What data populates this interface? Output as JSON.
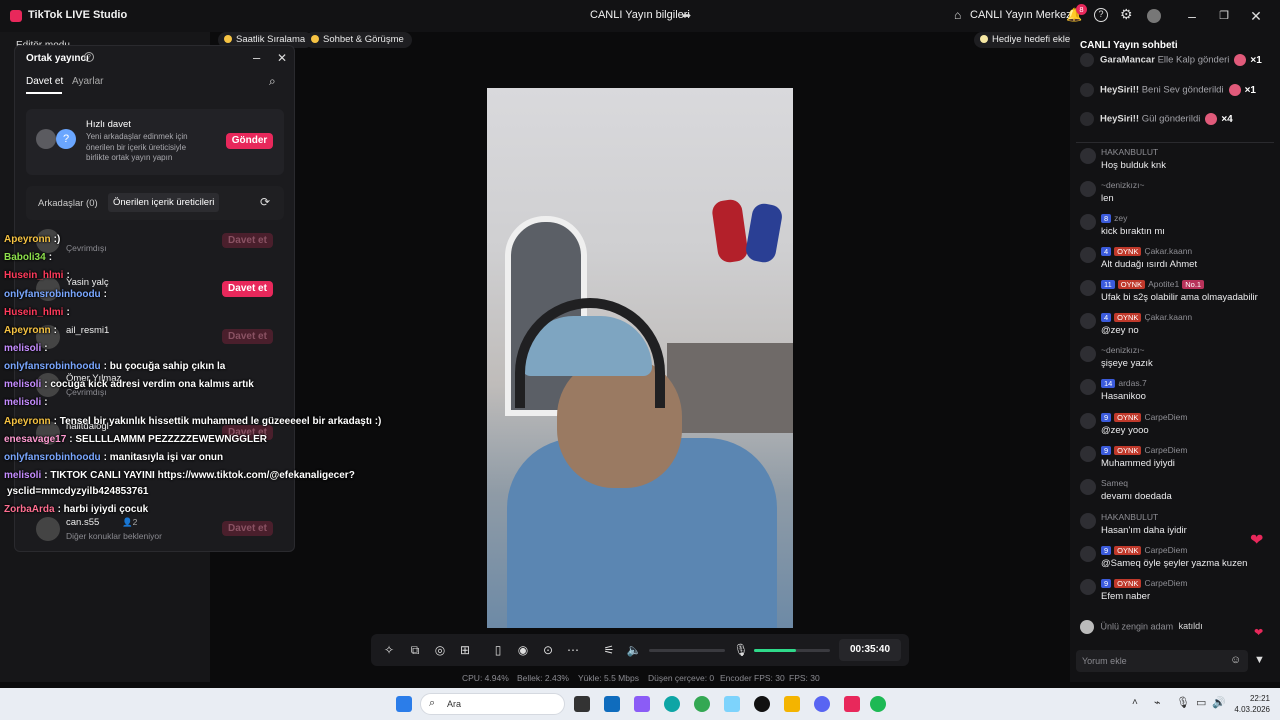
{
  "titlebar": {
    "app_name": "TikTok LIVE Studio",
    "center_title": "CANLI Yayın bilgileri",
    "live_center": "CANLI Yayın Merkezi",
    "notif_count": "8"
  },
  "left_panel": {
    "editor_mode": "Editör modu"
  },
  "scenes": {
    "pill1": "Saatlik Sıralama",
    "pill2": "Sohbet & Görüşme",
    "gift_goal": "Hediye hedefi ekle"
  },
  "cohost": {
    "title": "Ortak yayıncı",
    "tab_invite": "Davet et",
    "tab_settings": "Ayarlar",
    "quick_title": "Hızlı davet",
    "quick_desc": "Yeni arkadaşlar edinmek için önerilen bir içerik üreticisiyle birlikte ortak yayın yapın",
    "send": "Gönder",
    "seg_friends": "Arkadaşlar (0)",
    "seg_suggested": "Önerilen içerik üreticileri",
    "invite": "Davet et",
    "users": [
      {
        "name": "",
        "status": "Çevrimdışı"
      },
      {
        "name": "Yasin yalç",
        "status": ""
      },
      {
        "name": "ail_resmi1",
        "status": ""
      },
      {
        "name": "Ömer Yılmaz",
        "status": "Çevrimdışı"
      },
      {
        "name": "halitdalogl",
        "status": ""
      },
      {
        "name": "can.s55",
        "status": "Diğer konuklar bekleniyor",
        "count": "2"
      }
    ]
  },
  "overlay_chat": [
    {
      "user": "Apeyronn",
      "text": ":)",
      "color": "#f6c343"
    },
    {
      "user": "Baboli34",
      "text": ":",
      "color": "#8ee04c"
    },
    {
      "user": "Husein_hlmi",
      "text": ":",
      "color": "#ff3b5c"
    },
    {
      "user": "onlyfansrobinhoodu",
      "text": ":",
      "color": "#7aa7ff"
    },
    {
      "user": "Husein_hlmi",
      "text": ":",
      "color": "#ff3b5c"
    },
    {
      "user": "Apeyronn",
      "text": ":",
      "color": "#f6c343"
    },
    {
      "user": "melisoli",
      "text": ":",
      "color": "#c58cff"
    },
    {
      "user": "onlyfansrobinhoodu",
      "text": ": bu çocuğa sahip çıkın la",
      "color": "#7aa7ff"
    },
    {
      "user": "melisoli",
      "text": ": cocuga kick adresi verdim ona kalmıs artık",
      "color": "#c58cff"
    },
    {
      "user": "melisoli",
      "text": ":",
      "color": "#c58cff"
    },
    {
      "user": "Apeyronn",
      "text": ": Tensel bir yakınlık hissettik muhammed le güzeeeeel bir arkadaştı :)",
      "color": "#f6c343"
    },
    {
      "user": "enesavage17",
      "text": ": SELLLLAMMM PEZZZZZEWEWNGGLER",
      "color": "#ff9bd2"
    },
    {
      "user": "onlyfansrobinhoodu",
      "text": ": manitasıyla işi var onun",
      "color": "#7aa7ff"
    },
    {
      "user": "melisoli",
      "text": ": TIKTOK CANLI YAYINI https://www.tiktok.com/@efekanaligecer?",
      "color": "#c58cff"
    },
    {
      "user": "",
      "text": "ysclid=mmcdyzyilb424853761",
      "color": "#ffffff"
    },
    {
      "user": "ZorbaArda",
      "text": ": harbi iyiydi çocuk",
      "color": "#ff6f91"
    }
  ],
  "controls": {
    "timer": "00:35:40",
    "mic_level": 0.55
  },
  "status": {
    "cpu": "CPU: 4.94%",
    "mem": "Bellek: 2.43%",
    "upload": "Yükle: 5.5 Mbps",
    "dropped": "Düşen çerçeve: 0",
    "encoder": "Encoder FPS: 30",
    "fps": "FPS: 30"
  },
  "chat": {
    "title": "CANLI Yayın sohbeti",
    "gifts": [
      {
        "user": "GaraMancar",
        "action": "Elle Kalp gönderi",
        "count": "×1"
      },
      {
        "user": "HeySiri!!",
        "action": "Beni Sev gönderildi",
        "count": "×1"
      },
      {
        "user": "HeySiri!!",
        "action": "Gül gönderildi",
        "count": "×4"
      }
    ],
    "messages": [
      {
        "lvl": "",
        "fan": "",
        "user": "HAKANBULUT",
        "text": "Hoş bulduk knk"
      },
      {
        "lvl": "",
        "fan": "",
        "user": "~denizkızı~",
        "text": "len"
      },
      {
        "lvl": "8",
        "fan": "",
        "user": "zey",
        "text": "kick bıraktın mı"
      },
      {
        "lvl": "4",
        "fan": "OYNK",
        "user": "Çakar.kaann",
        "text": "Alt dudağı ısırdı Ahmet"
      },
      {
        "lvl": "11",
        "fan": "OYNK",
        "user": "Apotite1",
        "text": "Ufak bi s2ş olabilir ama olmayadabilir",
        "no1": "No.1"
      },
      {
        "lvl": "4",
        "fan": "OYNK",
        "user": "Çakar.kaann",
        "text": "@zey no"
      },
      {
        "lvl": "",
        "fan": "",
        "user": "~denizkızı~",
        "text": "şişeye yazık"
      },
      {
        "lvl": "14",
        "fan": "",
        "user": "ardas.7",
        "text": "Hasanikoo"
      },
      {
        "lvl": "9",
        "fan": "OYNK",
        "user": "CarpeDiem",
        "text": "@zey yooo"
      },
      {
        "lvl": "9",
        "fan": "OYNK",
        "user": "CarpeDiem",
        "text": "Muhammed iyiydi"
      },
      {
        "lvl": "",
        "fan": "",
        "user": "Sameq",
        "text": "devamı doedada"
      },
      {
        "lvl": "",
        "fan": "",
        "user": "HAKANBULUT",
        "text": "Hasan'ım daha iyidir"
      },
      {
        "lvl": "9",
        "fan": "OYNK",
        "user": "CarpeDiem",
        "text": "@Sameq öyle şeyler yazma kuzen"
      },
      {
        "lvl": "9",
        "fan": "OYNK",
        "user": "CarpeDiem",
        "text": "Efem naber"
      }
    ],
    "join_user": "Ünlü zengin adam",
    "join_text": "katıldı",
    "comment_placeholder": "Yorum ekle"
  },
  "taskbar": {
    "search": "Ara",
    "time": "22:21",
    "date": "4.03.2026"
  },
  "colors": {
    "accent": "#e8285b",
    "level": "#3b5bdb",
    "mic": "#2fd98a"
  }
}
